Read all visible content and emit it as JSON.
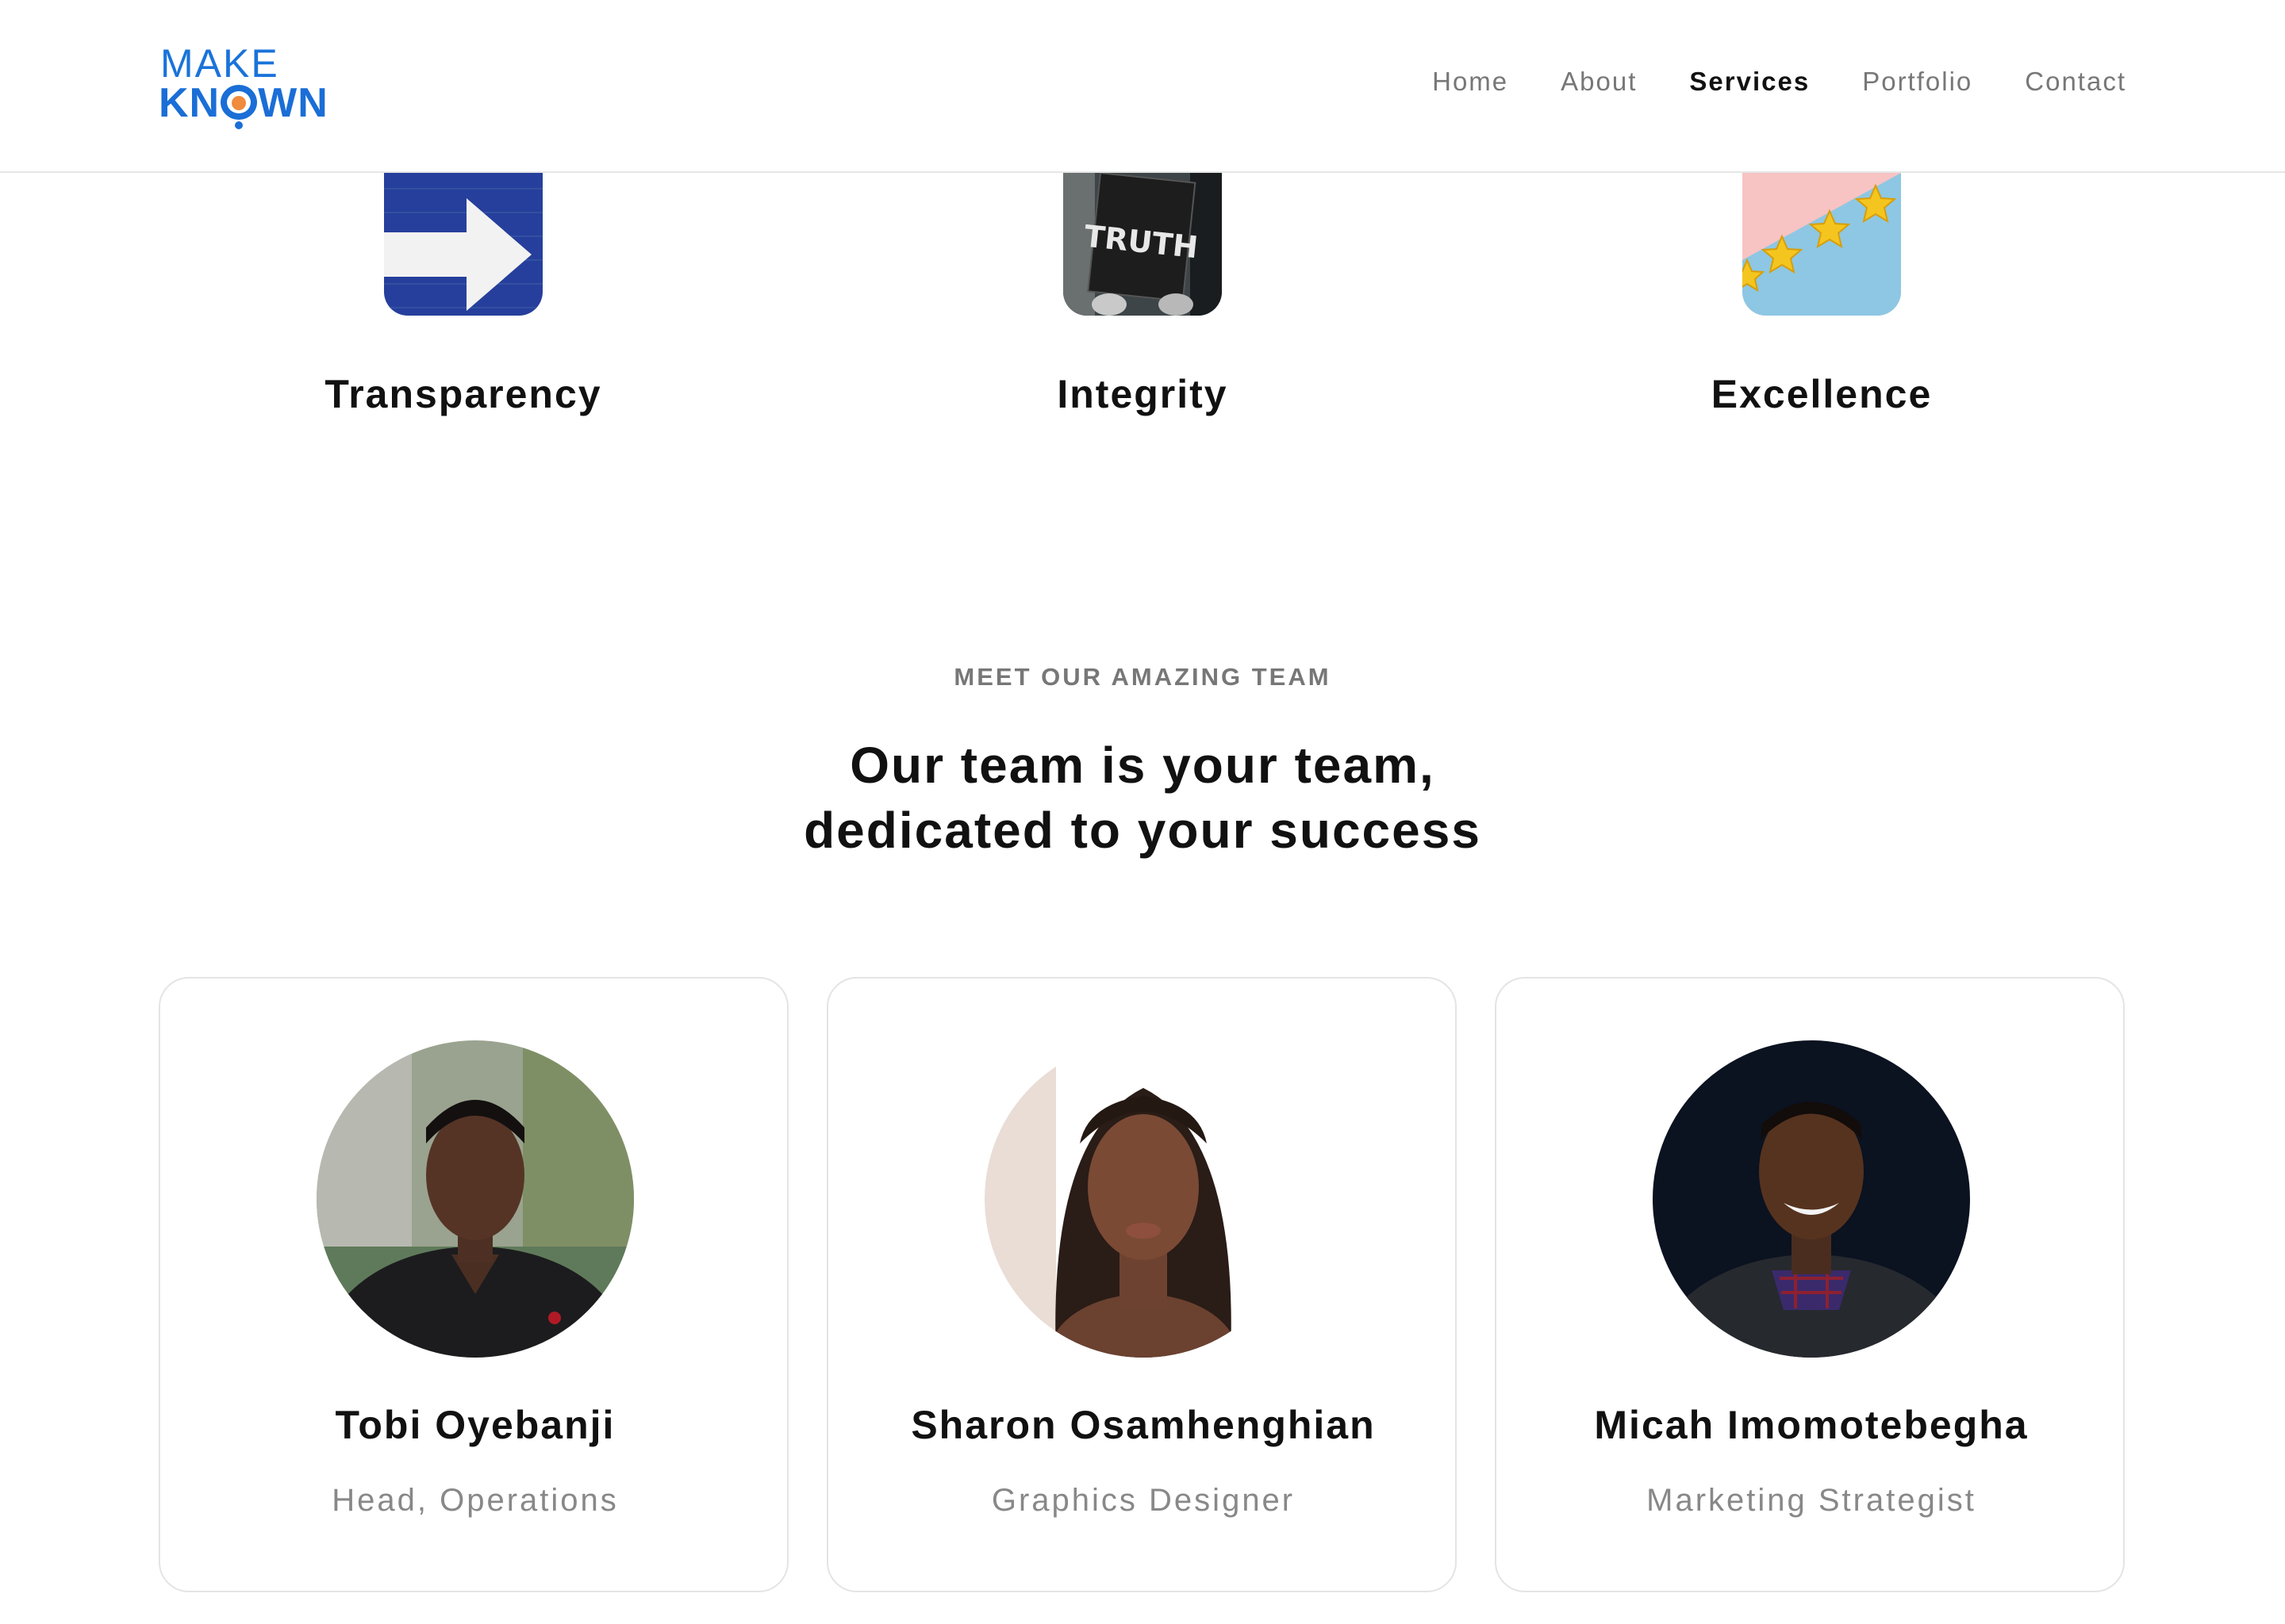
{
  "header": {
    "logo": {
      "line1": "MAKE",
      "line2_start": "KN",
      "line2_end": "WN"
    },
    "nav": [
      {
        "label": "Home",
        "active": false
      },
      {
        "label": "About",
        "active": false
      },
      {
        "label": "Services",
        "active": true
      },
      {
        "label": "Portfolio",
        "active": false
      },
      {
        "label": "Contact",
        "active": false
      }
    ]
  },
  "values": [
    {
      "title": "Transparency",
      "image": "arrow-sign-image"
    },
    {
      "title": "Integrity",
      "image": "truth-sign-image"
    },
    {
      "title": "Excellence",
      "image": "five-stars-image"
    }
  ],
  "team": {
    "eyebrow": "MEET OUR AMAZING TEAM",
    "heading_line1": "Our team is your team,",
    "heading_line2": "dedicated to your success",
    "members": [
      {
        "name": "Tobi Oyebanji",
        "role": "Head, Operations"
      },
      {
        "name": "Sharon Osamhenghian",
        "role": "Graphics Designer"
      },
      {
        "name": "Micah Imomotebegha",
        "role": "Marketing Strategist"
      }
    ]
  },
  "colors": {
    "brand_blue": "#1a6ed6",
    "brand_orange": "#f08a3c",
    "text_dark": "#111111",
    "text_muted": "#777777"
  }
}
